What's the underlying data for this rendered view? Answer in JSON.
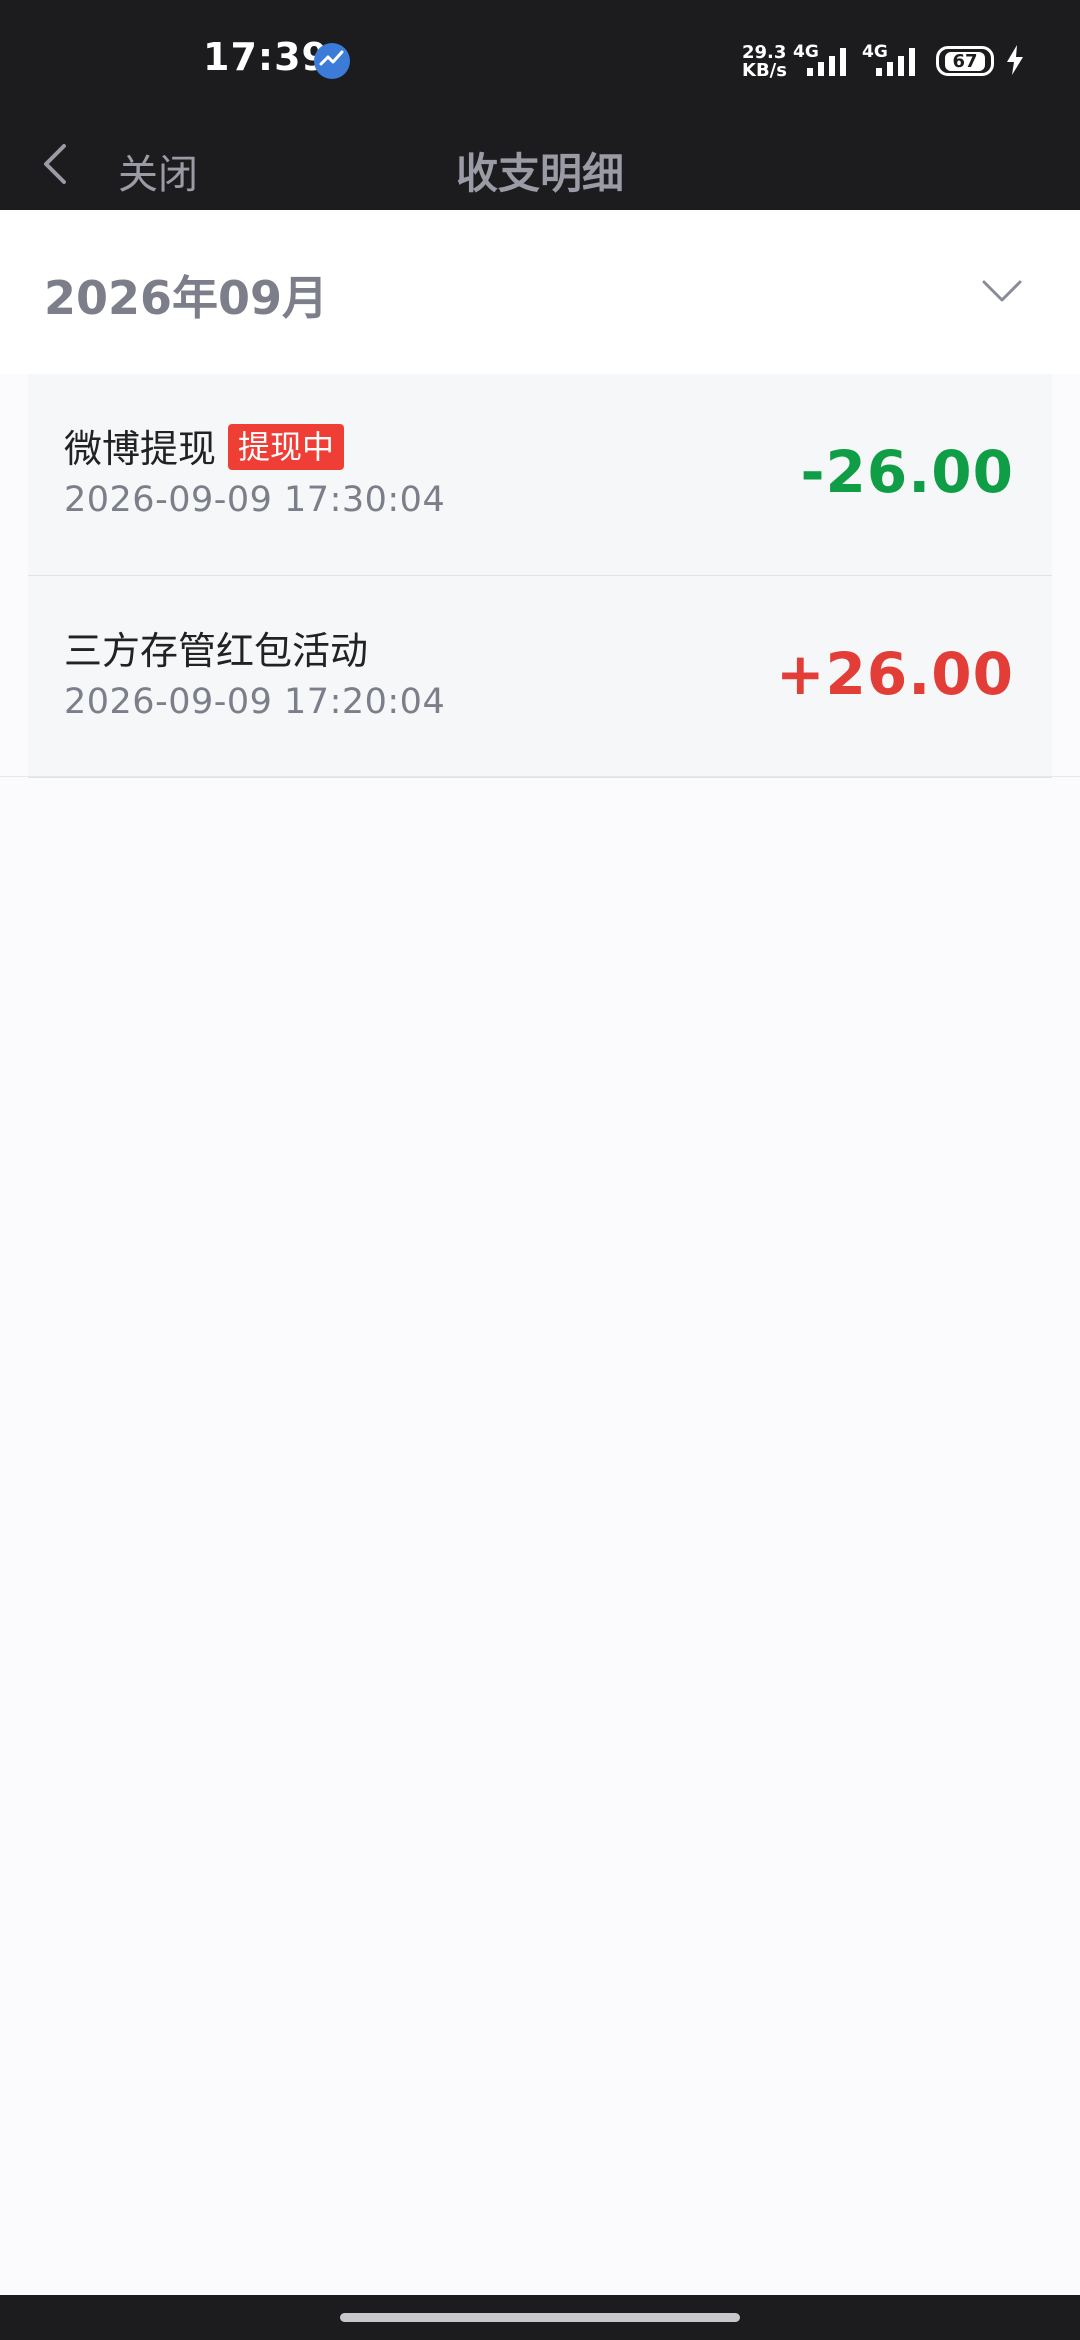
{
  "status_bar": {
    "time": "17:39",
    "net_speed_value": "29.3",
    "net_speed_unit": "KB/s",
    "network_1": "4G",
    "network_2": "4G",
    "battery": "67",
    "icons": [
      "app-notification-icon",
      "signal-icon",
      "battery-icon",
      "charging-bolt-icon"
    ]
  },
  "nav": {
    "close_label": "关闭",
    "title": "收支明细",
    "back_icon": "chevron-left-icon"
  },
  "filter": {
    "month": "2026年09月",
    "dropdown_icon": "chevron-down-icon"
  },
  "transactions": [
    {
      "title": "微博提现",
      "badge": "提现中",
      "time": "2026-09-09 17:30:04",
      "amount": "-26.00",
      "amount_color": "#0F9D45"
    },
    {
      "title": "三方存管红包活动",
      "badge": "",
      "time": "2026-09-09 17:20:04",
      "amount": "+26.00",
      "amount_color": "#E23D36"
    }
  ],
  "colors": {
    "header_bg": "#1C1C1E",
    "page_bg": "#FBFBFD",
    "badge_bg": "#EF3E36"
  }
}
